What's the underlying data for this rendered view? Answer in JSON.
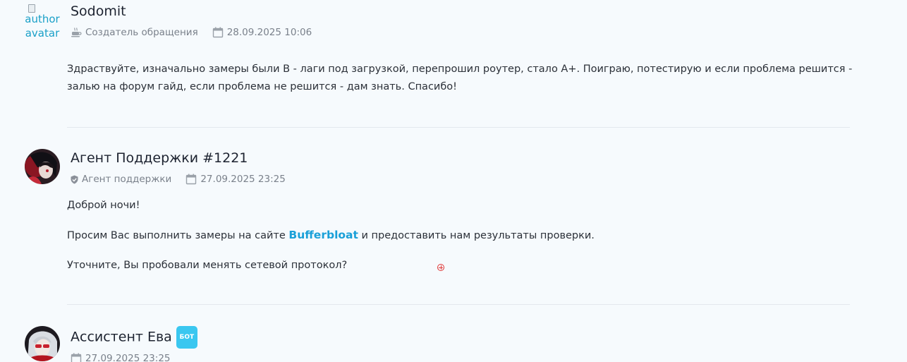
{
  "messages": [
    {
      "author_name": "Sodomit",
      "avatar_alt": "author avatar",
      "role": "Создатель обращения",
      "role_icon": "coffee-cup-icon",
      "datetime": "28.09.2025 10:06",
      "date_icon": "calendar-icon",
      "paragraphs": [
        "Здраствуйте, изначально замеры были B - лаги под загрузкой, перепрошил роутер, стало A+. Поиграю, потестирую и если проблема решится - залью на форум гайд, если проблема не решится - дам знать. Спасибо!"
      ]
    },
    {
      "author_name": "Агент Поддержки #1221",
      "role": "Агент поддержки",
      "role_icon": "shield-check-icon",
      "datetime": "27.09.2025 23:25",
      "date_icon": "calendar-icon",
      "paragraph_1": "Доброй ночи!",
      "paragraph_2_before": "Просим Вас выполнить замеры на сайте ",
      "paragraph_2_link": "Bufferbloat",
      "paragraph_2_after": " и предоставить нам результаты проверки.",
      "paragraph_3": "Уточните, Вы пробовали менять сетевой протокол?"
    },
    {
      "author_name": "Ассистент Ева",
      "badge": "БОТ",
      "datetime": "27.09.2025 23:25",
      "date_icon": "calendar-icon"
    }
  ],
  "colors": {
    "page_background": "#f6fafd",
    "link": "#1aa0d8",
    "bot_badge": "#3ac7f0",
    "meta_text": "#7a818b",
    "divider": "#e3e8ee"
  }
}
